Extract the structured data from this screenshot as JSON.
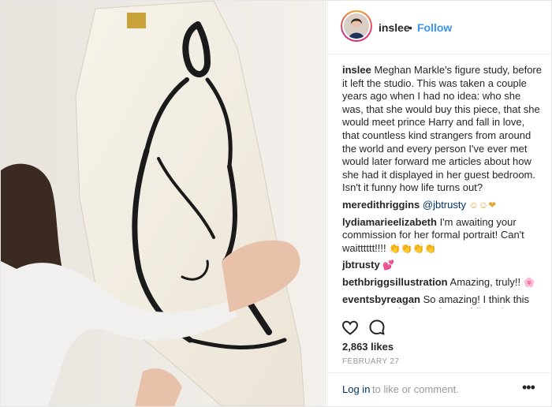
{
  "post": {
    "username": "inslee",
    "follow_label": "Follow",
    "separator": "•"
  },
  "caption": {
    "username": "inslee",
    "text": " Meghan Markle's figure study, before it left the studio. This was taken a couple years ago when I had no idea: who she was, that she would buy this piece, that she would meet prince Harry and fall in love, that countless kind strangers from around the world and every person I've ever met would later forward me articles about how she had it displayed in her guest bedroom. Isn't it funny how life turns out?"
  },
  "comments": [
    {
      "username": "meredithriggins",
      "mention": "@jbtrusty",
      "text": " ",
      "emoji": "☺☺❤"
    },
    {
      "username": "lydiamarieelizabeth",
      "text": " I'm awaiting your commission for her formal portrait! Can't waitttttt!!!! ",
      "emoji": "👏👏👏👏"
    },
    {
      "username": "jbtrusty",
      "text": " ",
      "emoji": "💕"
    },
    {
      "username": "bethbriggsillustration",
      "text": " Amazing, truly!! ",
      "emoji": "🌸"
    },
    {
      "username": "eventsbyreagan",
      "text": " So amazing! I think this warrants an invite to the wedding, don't you? :)"
    }
  ],
  "icons": {
    "like": "heart-icon",
    "comment": "comment-icon",
    "more": "more-options-icon"
  },
  "likes_text": "2,863 likes",
  "date_text": "FEBRUARY 27",
  "footer": {
    "login_label": "Log in",
    "rest": "to like or comment.",
    "more": "•••"
  },
  "colors": {
    "link": "#3897f0",
    "mention": "#003569",
    "text": "#262626",
    "muted": "#999999"
  }
}
